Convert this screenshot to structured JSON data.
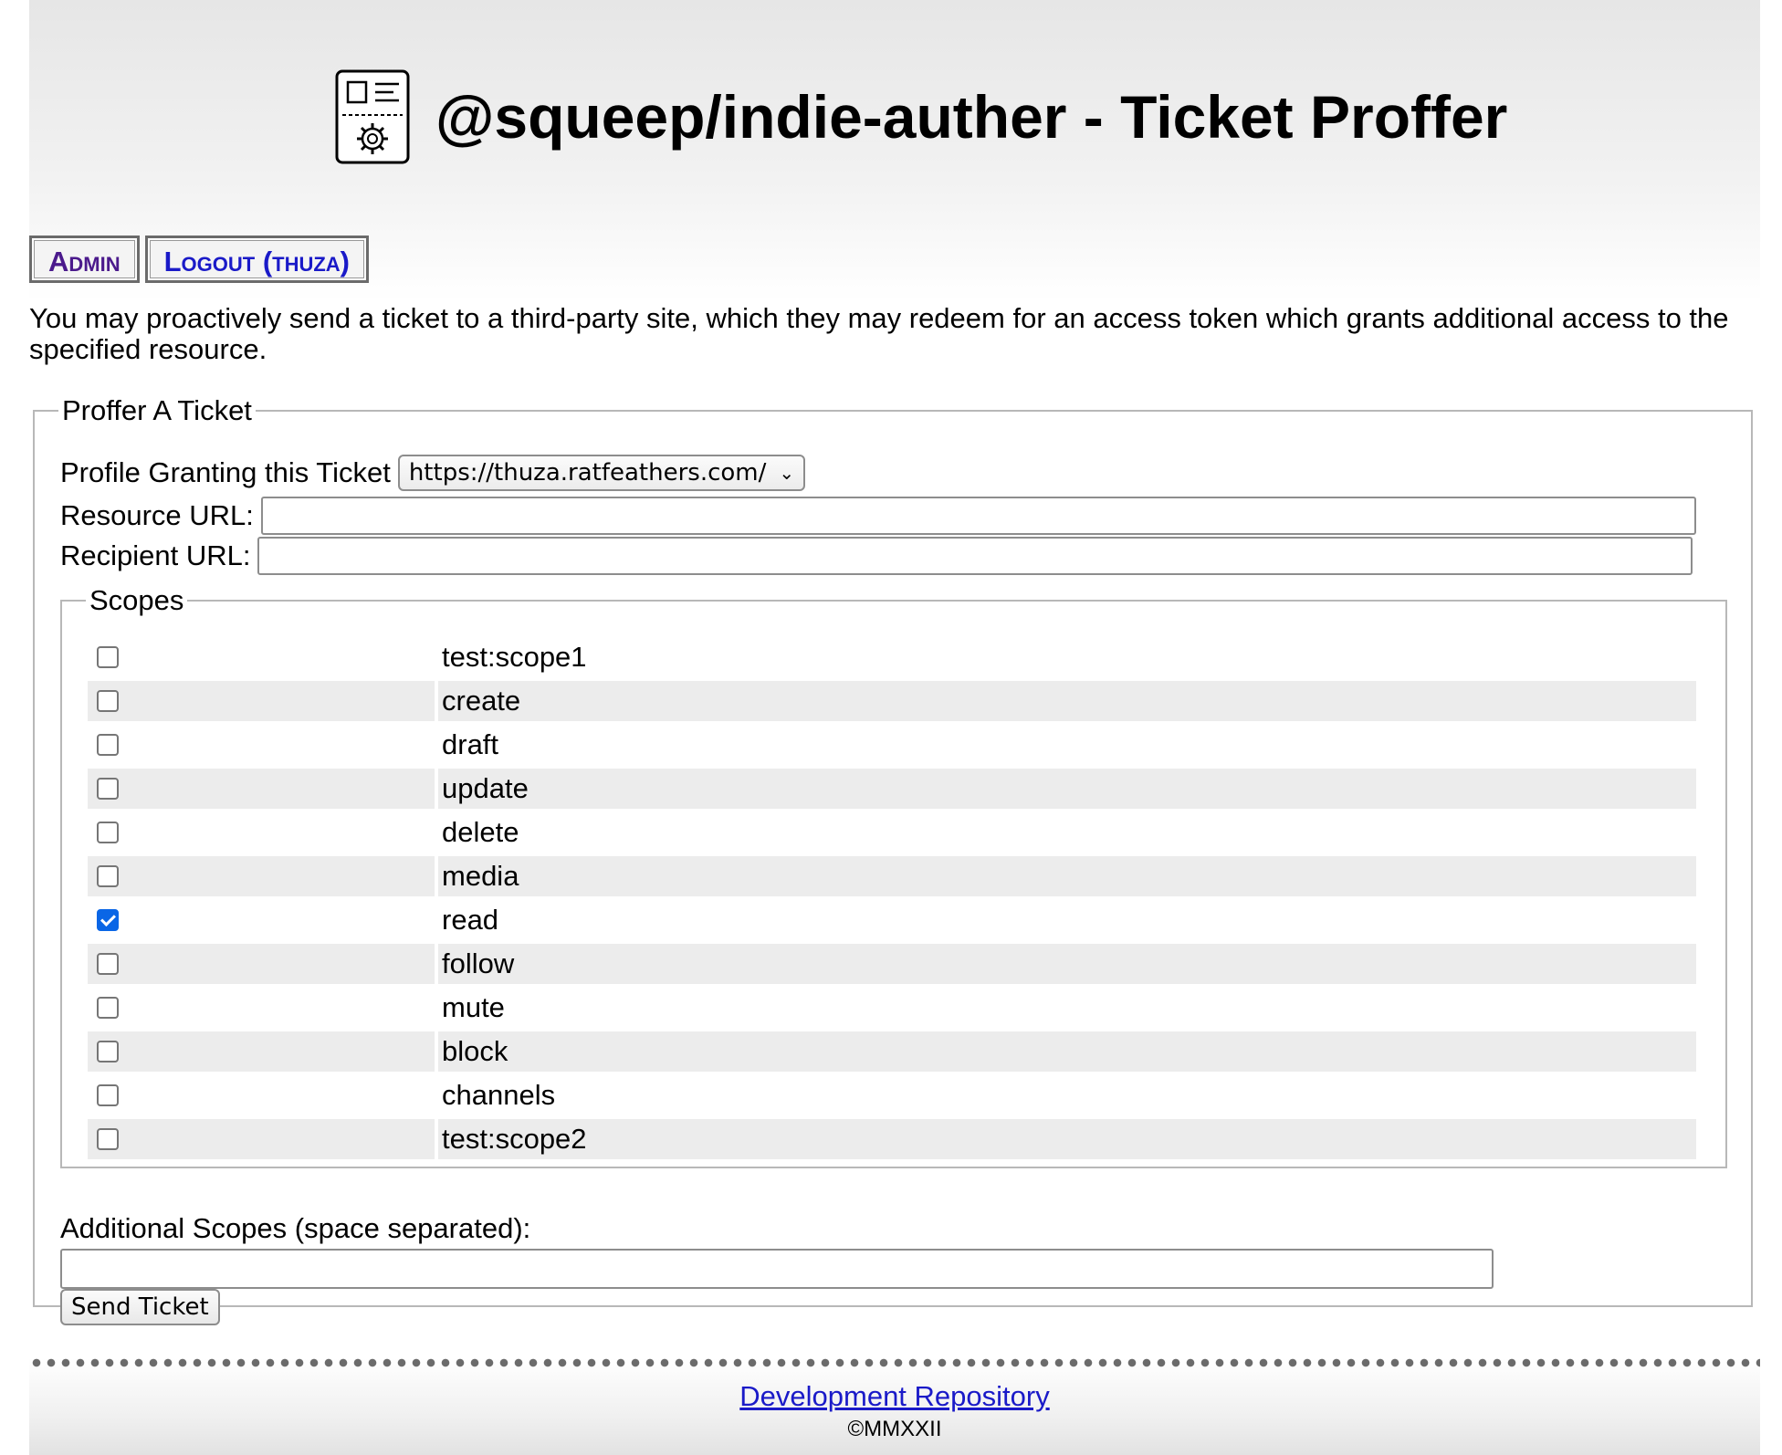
{
  "header": {
    "title": "@squeep/indie-auther - Ticket Proffer",
    "logo_icon": "ticket-gear-icon"
  },
  "nav": {
    "admin_label": "Admin",
    "logout_label": "Logout (thuza)"
  },
  "intro": "You may proactively send a ticket to a third-party site, which they may redeem for an access token which grants additional access to the specified resource.",
  "form": {
    "legend": "Proffer A Ticket",
    "profile_label": "Profile Granting this Ticket",
    "profile_selected": "https://thuza.ratfeathers.com/",
    "resource_label": "Resource URL:",
    "resource_value": "",
    "recipient_label": "Recipient URL:",
    "recipient_value": "",
    "scopes_legend": "Scopes",
    "scopes": [
      {
        "name": "test:scope1",
        "checked": false
      },
      {
        "name": "create",
        "checked": false
      },
      {
        "name": "draft",
        "checked": false
      },
      {
        "name": "update",
        "checked": false
      },
      {
        "name": "delete",
        "checked": false
      },
      {
        "name": "media",
        "checked": false
      },
      {
        "name": "read",
        "checked": true
      },
      {
        "name": "follow",
        "checked": false
      },
      {
        "name": "mute",
        "checked": false
      },
      {
        "name": "block",
        "checked": false
      },
      {
        "name": "channels",
        "checked": false
      },
      {
        "name": "test:scope2",
        "checked": false
      }
    ],
    "additional_label": "Additional Scopes (space separated):",
    "additional_value": "",
    "send_label": "Send Ticket"
  },
  "footer": {
    "repo_link": "Development Repository",
    "copyright": "©MMXXII"
  },
  "colors": {
    "link": "#1a1ac8",
    "visited": "#4b1a8c",
    "checkbox_checked": "#0a66e6",
    "row_stripe": "#ececec"
  }
}
